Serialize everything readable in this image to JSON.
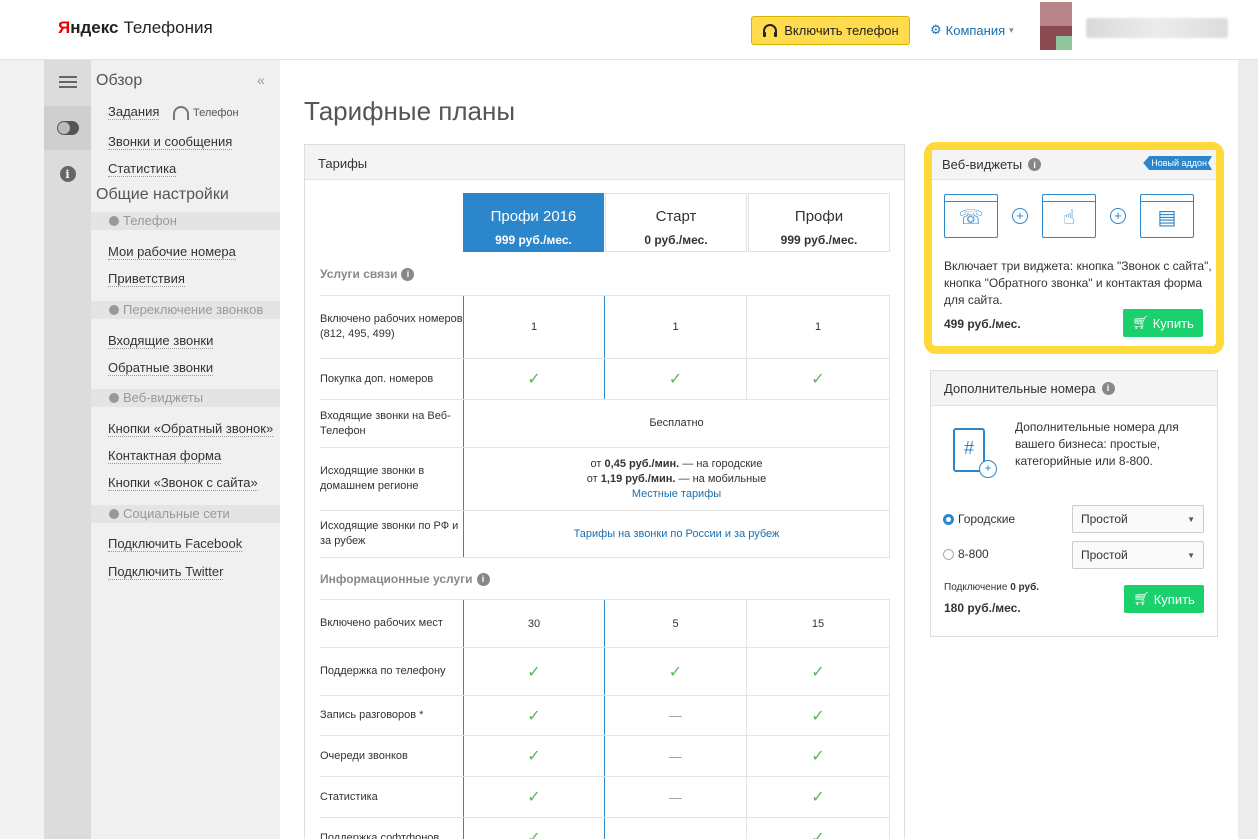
{
  "header": {
    "logo_ya": "Я",
    "logo_ndex": "ндекс",
    "logo_product": "Телефония",
    "phone_button": "Включить телефон",
    "company": "Компания"
  },
  "sidebar": {
    "overview": "Обзор",
    "tasks": "Задания",
    "phone_sub": "Телефон",
    "calls_messages": "Звонки и сообщения",
    "stats": "Статистика",
    "general_settings": "Общие настройки",
    "sec_phone": "Телефон",
    "my_numbers": "Мои рабочие номера",
    "greetings": "Приветствия",
    "sec_switching": "Переключение звонков",
    "incoming": "Входящие звонки",
    "callback_calls": "Обратные звонки",
    "sec_widgets": "Веб-виджеты",
    "callback_buttons": "Кнопки «Обратный звонок»",
    "contact_form": "Контактная форма",
    "call_from_site": "Кнопки «Звонок с сайта»",
    "sec_social": "Социальные сети",
    "facebook": "Подключить Facebook",
    "twitter": "Подключить Twitter"
  },
  "main": {
    "title": "Тарифные планы",
    "tariffs_header": "Тарифы",
    "plans": [
      {
        "name": "Профи 2016",
        "price": "999 руб./мес."
      },
      {
        "name": "Старт",
        "price": "0 руб./мес."
      },
      {
        "name": "Профи",
        "price": "999 руб./мес."
      }
    ],
    "group_comm": "Услуги связи",
    "group_info": "Информационные услуги",
    "rows": {
      "r1_label": "Включено рабочих номеров (812, 495, 499)",
      "r1_v": [
        "1",
        "1",
        "1"
      ],
      "r2_label": "Покупка доп. номеров",
      "r3_label": "Входящие звонки на Веб-Телефон",
      "r3_value": "Бесплатно",
      "r4_label": "Исходящие звонки в домашнем регионе",
      "r4_line1_pre": "от ",
      "r4_line1_b": "0,45 руб./мин.",
      "r4_line1_post": " — на городские",
      "r4_line2_pre": "от ",
      "r4_line2_b": "1,19 руб./мин.",
      "r4_line2_post": " — на мобильные",
      "r4_link": "Местные тарифы",
      "r5_label": "Исходящие звонки по РФ и за рубеж",
      "r5_link": "Тарифы на звонки по России и за рубеж",
      "r6_label": "Включено рабочих мест",
      "r6_v": [
        "30",
        "5",
        "15"
      ],
      "r7_label": "Поддержка по телефону",
      "r8_label": "Запись разговоров *",
      "r9_label": "Очереди звонков",
      "r10_label": "Статистика",
      "r11_label": "Поддержка софтфонов"
    },
    "check": "✓",
    "dash": "—"
  },
  "widget_card": {
    "title": "Веб-виджеты",
    "badge": "Новый аддон",
    "description": "Включает три виджета: кнопка \"Звонок с сайта\", кнопка \"Обратного звонка\" и контактая форма для сайта.",
    "price": "499 руб./мес.",
    "buy": "Купить"
  },
  "extra_card": {
    "title": "Дополнительные номера",
    "description": "Дополнительные номера для вашего бизнеса: простые, категорийные или 8-800.",
    "radio_city": "Городские",
    "radio_800": "8-800",
    "select_city": "Простой",
    "select_800": "Простой",
    "connection_pre": "Подключение ",
    "connection_val": "0 руб.",
    "price": "180 руб./мес.",
    "buy": "Купить"
  },
  "colors": {
    "accent": "#2b86cc",
    "highlight": "#ffd83a",
    "buy_green": "#1bd16d",
    "phone_button": "#ffdb4d"
  }
}
